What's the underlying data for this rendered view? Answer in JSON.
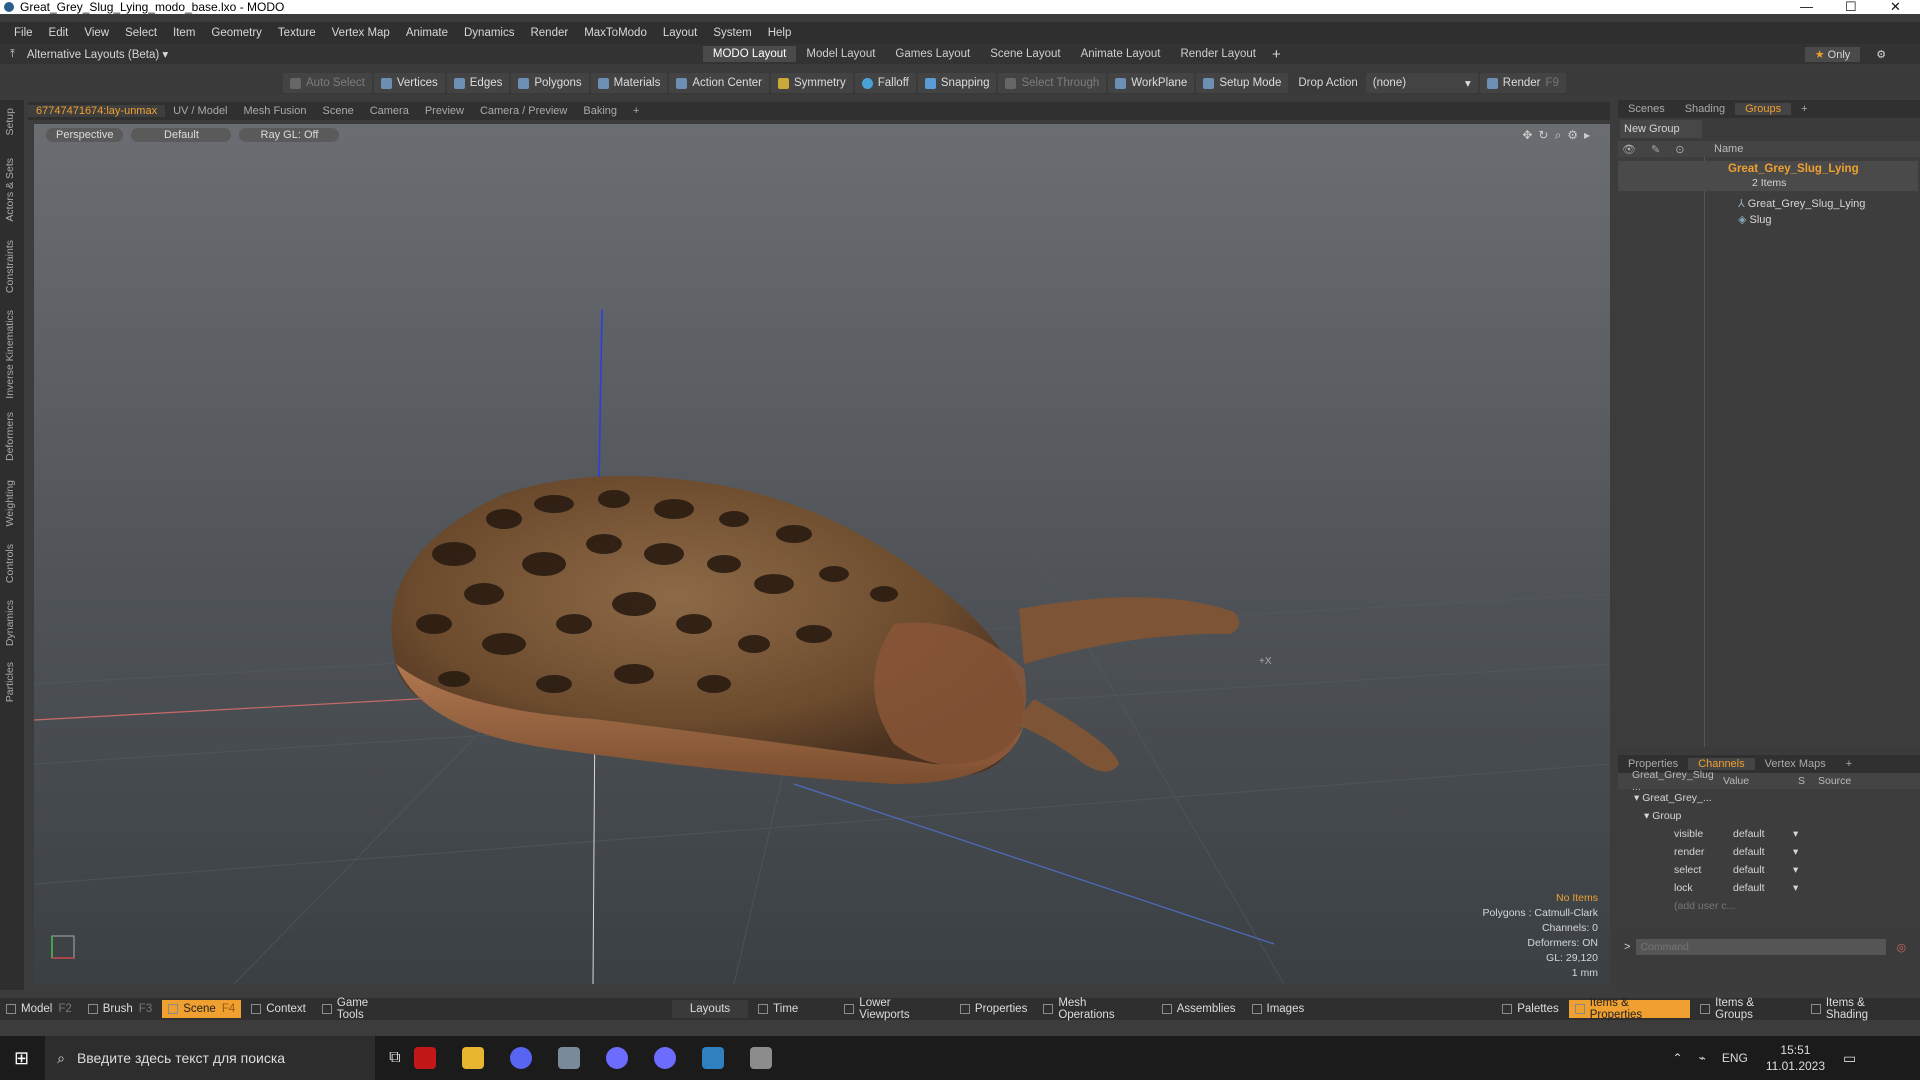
{
  "window": {
    "title": "Great_Grey_Slug_Lying_modo_base.lxo - MODO"
  },
  "menu": [
    "File",
    "Edit",
    "View",
    "Select",
    "Item",
    "Geometry",
    "Texture",
    "Vertex Map",
    "Animate",
    "Dynamics",
    "Render",
    "MaxToModo",
    "Layout",
    "System",
    "Help"
  ],
  "layouts": {
    "alt": "Alternative Layouts (Beta) ▾",
    "tabs": [
      "MODO Layout",
      "Model Layout",
      "Games Layout",
      "Scene Layout",
      "Animate Layout",
      "Render Layout"
    ],
    "only": "Only"
  },
  "toolbar": {
    "auto_select": "Auto Select",
    "vertices": "Vertices",
    "edges": "Edges",
    "polygons": "Polygons",
    "materials": "Materials",
    "action_center": "Action Center",
    "symmetry": "Symmetry",
    "falloff": "Falloff",
    "snapping": "Snapping",
    "select_through": "Select Through",
    "workplane": "WorkPlane",
    "setup_mode": "Setup Mode",
    "drop_action": "Drop Action",
    "drop_value": "(none)",
    "render": "Render",
    "render_key": "F9"
  },
  "viewport_tabs": [
    "67747471674:lay-unmax",
    "UV / Model",
    "Mesh Fusion",
    "Scene",
    "Camera",
    "Preview",
    "Camera / Preview",
    "Baking"
  ],
  "viewport": {
    "projection": "Perspective",
    "shading": "Default",
    "raygl": "Ray GL: Off",
    "info": {
      "items": "No Items",
      "polygons": "Polygons : Catmull-Clark",
      "channels": "Channels: 0",
      "deformers": "Deformers: ON",
      "gl": "GL: 29,120",
      "scale": "1 mm"
    }
  },
  "left_tabs": [
    "Setup",
    "Actors & Sets",
    "Constraints",
    "Inverse Kinematics",
    "Deformers",
    "Weighting",
    "Controls",
    "Dynamics",
    "Particles"
  ],
  "right_panel": {
    "tabs": [
      "Scenes",
      "Shading",
      "Groups"
    ],
    "new_group": "New Group",
    "name_col": "Name",
    "group_name": "Great_Grey_Slug_Lying",
    "group_count": "2 Items",
    "children": [
      "Great_Grey_Slug_Lying",
      "Slug"
    ]
  },
  "channels": {
    "tabs": [
      "Properties",
      "Channels",
      "Vertex Maps"
    ],
    "col_item": "Great_Grey_Slug ...",
    "col_value": "Value",
    "col_s": "S",
    "col_source": "Source",
    "root": "Great_Grey_...",
    "group": "Group",
    "rows": [
      {
        "name": "visible",
        "value": "default"
      },
      {
        "name": "render",
        "value": "default"
      },
      {
        "name": "select",
        "value": "default"
      },
      {
        "name": "lock",
        "value": "default"
      }
    ],
    "add": "(add user c...",
    "command_placeholder": "Command"
  },
  "bottom": {
    "left": [
      {
        "label": "Model",
        "key": "F2"
      },
      {
        "label": "Brush",
        "key": "F3"
      },
      {
        "label": "Scene",
        "key": "F4"
      },
      {
        "label": "Context",
        "key": ""
      },
      {
        "label": "Game Tools",
        "key": ""
      }
    ],
    "mid": [
      "Layouts",
      "Time",
      "Lower Viewports",
      "Properties",
      "Mesh Operations",
      "Assemblies",
      "Images"
    ],
    "right": [
      "Palettes",
      "Items & Properties",
      "Items & Groups",
      "Items & Shading"
    ]
  },
  "taskbar": {
    "search_placeholder": "Введите здесь текст для поиска",
    "lang": "ENG",
    "time": "15:51",
    "date": "11.01.2023"
  }
}
